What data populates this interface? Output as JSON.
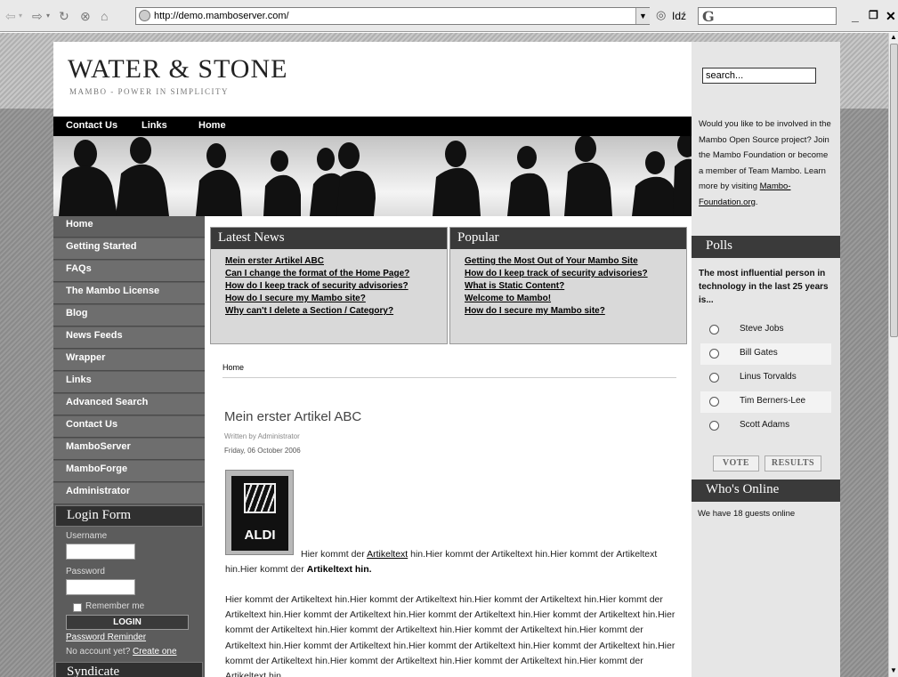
{
  "browser": {
    "url": "http://demo.mamboserver.com/",
    "go_label": "Idź",
    "search_engine_glyph": "G"
  },
  "site": {
    "title": "WATER & STONE",
    "subtitle": "MAMBO - POWER IN SIMPLICITY"
  },
  "topnav": [
    "Contact Us",
    "Links",
    "Home"
  ],
  "leftnav": [
    "Home",
    "Getting Started",
    "FAQs",
    "The Mambo License",
    "Blog",
    "News Feeds",
    "Wrapper",
    "Links",
    "Advanced Search",
    "Contact Us",
    "MamboServer",
    "MamboForge",
    "Administrator"
  ],
  "login": {
    "heading": "Login Form",
    "username_label": "Username",
    "password_label": "Password",
    "remember_label": "Remember me",
    "button": "LOGIN",
    "reminder": "Password Reminder",
    "no_account": "No account yet?",
    "create": "Create one"
  },
  "syndicate": "Syndicate",
  "latest_news": {
    "heading": "Latest News",
    "items": [
      "Mein erster Artikel ABC",
      "Can I change the format of the Home Page?",
      "How do I keep track of security advisories?",
      "How do I secure my Mambo site?",
      "Why can't I delete a Section / Category?"
    ]
  },
  "popular": {
    "heading": "Popular",
    "items": [
      "Getting the Most Out of Your Mambo Site",
      "How do I keep track of security advisories?",
      "What is Static Content?",
      "Welcome to Mambo!",
      "How do I secure my Mambo site?"
    ]
  },
  "breadcrumb": "Home",
  "article": {
    "title": "Mein erster Artikel ABC",
    "author": "Written by Administrator",
    "date": "Friday, 06 October 2006",
    "image_label": "ALDI",
    "intro_a": "Hier kommt der ",
    "intro_link": "Artikeltext",
    "intro_b": " hin.Hier kommt der Artikeltext hin.Hier kommt der Artikeltext hin.Hier kommt der ",
    "intro_bold": "Artikeltext hin.",
    "body": "Hier kommt der Artikeltext hin.Hier kommt der Artikeltext hin.Hier kommt der Artikeltext hin.Hier kommt der Artikeltext hin.Hier kommt der Artikeltext hin.Hier kommt der Artikeltext hin.Hier kommt der Artikeltext hin.Hier kommt der Artikeltext hin.Hier kommt der Artikeltext hin.Hier kommt der Artikeltext hin.Hier kommt der Artikeltext hin.Hier kommt der Artikeltext hin.Hier kommt der Artikeltext hin.Hier kommt der Artikeltext hin.Hier kommt der Artikeltext hin.Hier kommt der Artikeltext hin.Hier kommt der Artikeltext hin.Hier kommt der Artikeltext hin."
  },
  "right": {
    "search_value": "search...",
    "invite_text": "Would you like to be involved in the Mambo Open Source project? Join the Mambo Foundation or become a member of Team Mambo. Learn more by visiting ",
    "invite_link": "Mambo-Foundation.org",
    "invite_end": "."
  },
  "polls": {
    "heading": "Polls",
    "question": "The most influential person in technology in the last 25 years is...",
    "options": [
      "Steve Jobs",
      "Bill Gates",
      "Linus Torvalds",
      "Tim Berners-Lee",
      "Scott Adams"
    ],
    "vote": "VOTE",
    "results": "RESULTS"
  },
  "online": {
    "heading": "Who's Online",
    "text": "We have 18 guests online"
  }
}
